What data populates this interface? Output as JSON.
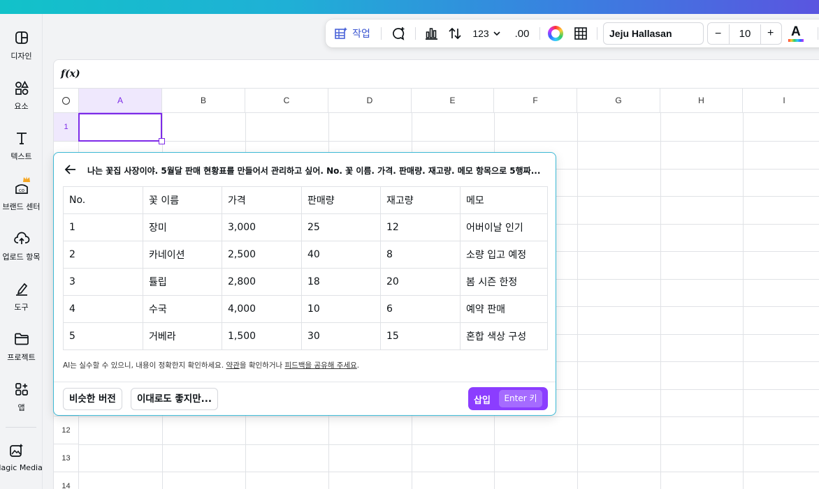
{
  "toolbar": {
    "action_label": "작업",
    "number_format": "123",
    "decimal_label": ".00",
    "font_name": "Jeju Hallasan",
    "font_size": "10",
    "minus": "−",
    "plus": "+",
    "text_color_letter": "A"
  },
  "sidebar": {
    "items": [
      {
        "label": "디자인",
        "icon": "design-icon"
      },
      {
        "label": "요소",
        "icon": "elements-icon"
      },
      {
        "label": "텍스트",
        "icon": "text-icon"
      },
      {
        "label": "브랜드 센터",
        "icon": "brand-icon"
      },
      {
        "label": "업로드 항목",
        "icon": "upload-icon"
      },
      {
        "label": "도구",
        "icon": "draw-icon"
      },
      {
        "label": "프로젝트",
        "icon": "folder-icon"
      },
      {
        "label": "앱",
        "icon": "apps-icon"
      },
      {
        "label": "Magic Media",
        "icon": "magic-media-icon"
      }
    ]
  },
  "sheet": {
    "formula_label": "f(x)",
    "columns": [
      "A",
      "B",
      "C",
      "D",
      "E",
      "F",
      "G",
      "H",
      "I"
    ],
    "rows": [
      "1",
      "12",
      "13",
      "14"
    ]
  },
  "panel": {
    "prompt": "나는 꽃집 사장이야. 5월달 판매 현황표를 만들어서 관리하고 싶어. No. 꽃 이름. 가격. 판매량. 재고량. 메모 항목으로 5행짜...",
    "table": {
      "headers": [
        "No.",
        "꽃 이름",
        "가격",
        "판매량",
        "재고량",
        "메모"
      ],
      "rows": [
        [
          "1",
          "장미",
          "3,000",
          "25",
          "12",
          "어버이날 인기"
        ],
        [
          "2",
          "카네이션",
          "2,500",
          "40",
          "8",
          "소량 입고 예정"
        ],
        [
          "3",
          "튤립",
          "2,800",
          "18",
          "20",
          "봄 시즌 한정"
        ],
        [
          "4",
          "수국",
          "4,000",
          "10",
          "6",
          "예약 판매"
        ],
        [
          "5",
          "거베라",
          "1,500",
          "30",
          "15",
          "혼합 색상 구성"
        ]
      ]
    },
    "disclaimer_prefix": "AI는 실수할 수 있으니, 내용이 정확한지 확인하세요. ",
    "terms_link": "약관",
    "disclaimer_mid": "을 확인하거나 ",
    "feedback_link": "피드백을 공유해 주세요",
    "disclaimer_end": ".",
    "similar_button": "비슷한 버전",
    "alt_button": "이대로도 좋지만...",
    "insert_label": "삽입",
    "insert_key": "Enter 키"
  },
  "colors": {
    "accent": "#7d2ae8",
    "insert_button": "#8b3dff",
    "panel_border": "#3cb8d4"
  }
}
